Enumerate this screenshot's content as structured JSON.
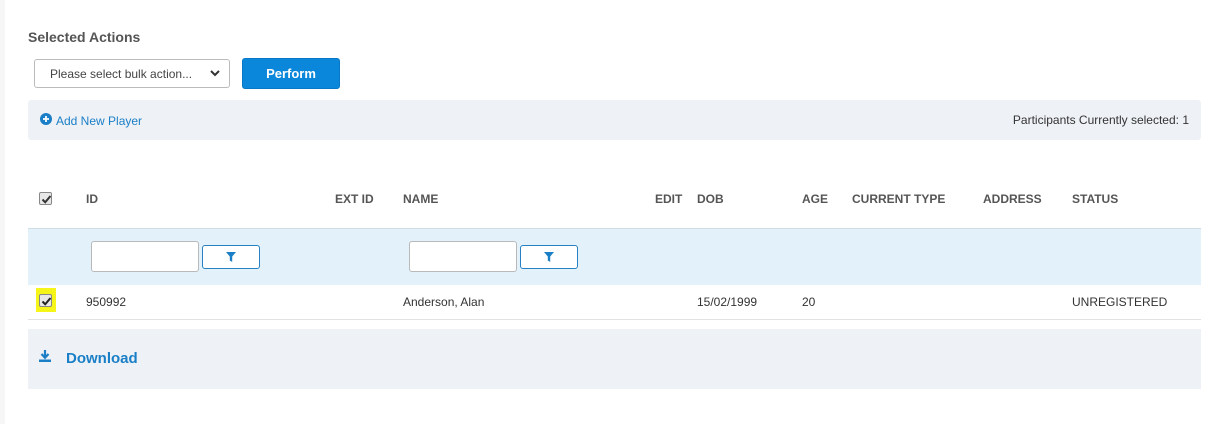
{
  "section_title": "Selected Actions",
  "bulk_action": {
    "placeholder": "Please select bulk action..."
  },
  "perform_label": "Perform",
  "toolbar": {
    "add_player_label": "Add New Player",
    "selected_text": "Participants Currently selected: 1"
  },
  "table": {
    "headers": {
      "id": "ID",
      "ext_id": "EXT ID",
      "name": "NAME",
      "edit": "EDIT",
      "dob": "DOB",
      "age": "AGE",
      "current_type": "CURRENT TYPE",
      "address": "ADDRESS",
      "status": "STATUS"
    },
    "rows": [
      {
        "checked": true,
        "id": "950992",
        "ext_id": "",
        "name": "Anderson, Alan",
        "dob": "15/02/1999",
        "age": "20",
        "current_type": "",
        "address": "",
        "status": "UNREGISTERED"
      }
    ]
  },
  "download_label": "Download",
  "colors": {
    "accent": "#0a86db",
    "link": "#1a7fc6",
    "filter_row": "#e3f1fa",
    "highlight": "#f5f51a"
  }
}
